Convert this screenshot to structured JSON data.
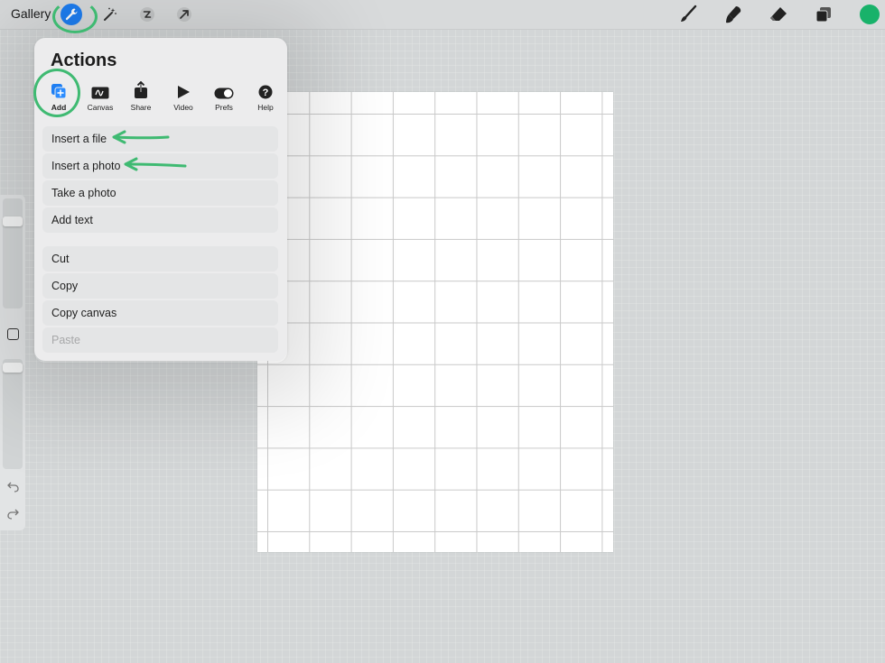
{
  "topbar": {
    "gallery_label": "Gallery",
    "left_tools": [
      "wrench-icon",
      "magic-wand-icon",
      "selection-icon",
      "transform-arrow-icon"
    ],
    "right_tools": [
      "brush-icon",
      "smudge-icon",
      "eraser-icon",
      "layers-icon"
    ],
    "current_color": "#18b26a",
    "active_tool_color": "#1e7ef2"
  },
  "actions_panel": {
    "title": "Actions",
    "tabs": [
      {
        "label": "Add",
        "icon": "add-icon",
        "active": true
      },
      {
        "label": "Canvas",
        "icon": "canvas-icon",
        "active": false
      },
      {
        "label": "Share",
        "icon": "share-icon",
        "active": false
      },
      {
        "label": "Video",
        "icon": "video-play-icon",
        "active": false
      },
      {
        "label": "Prefs",
        "icon": "toggle-icon",
        "active": false
      },
      {
        "label": "Help",
        "icon": "help-icon",
        "active": false
      }
    ],
    "group1": [
      "Insert a file",
      "Insert a photo",
      "Take a photo",
      "Add text"
    ],
    "group2": [
      "Cut",
      "Copy",
      "Copy canvas",
      "Paste"
    ],
    "disabled": [
      "Paste"
    ]
  },
  "annotations": {
    "color": "#3fba72"
  }
}
